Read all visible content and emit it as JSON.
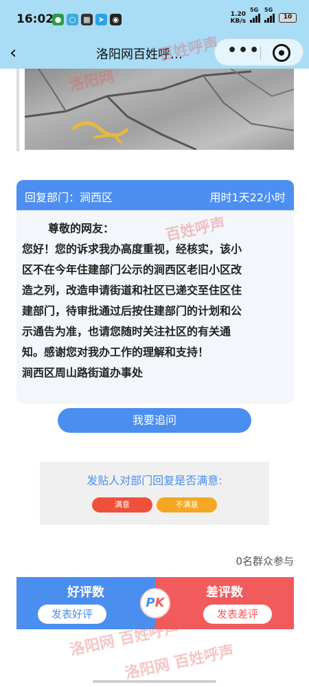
{
  "status_bar": {
    "time": "16:02",
    "net_speed_value": "1.20",
    "net_speed_unit": "KB/s",
    "signal1_label": "5G",
    "signal2_label": "5G",
    "battery": "10"
  },
  "nav": {
    "title": "洛阳网百姓呼…"
  },
  "reply": {
    "dept_label": "回复部门：涧西区",
    "duration": "用时1天22小时",
    "greeting": "尊敬的网友：",
    "lines": [
      "您好！您的诉求我办高度重视，经核实，该小",
      "区不在今年住建部门公示的涧西区老旧小区改",
      "造之列，改造申请街道和社区已递交至住区住",
      "建部门，待审批通过后按住建部门的计划和公",
      "示通告为准，也请您随时关注社区的有关通",
      "知。感谢您对我办工作的理解和支持！",
      "涧西区周山路街道办事处"
    ]
  },
  "followup_label": "我要追问",
  "satisfaction": {
    "title": "发贴人对部门回复是否满意:",
    "yes_label": "满意",
    "no_label": "不满意"
  },
  "participants": "0名群众参与",
  "reviews": {
    "good_title": "好评数",
    "good_button": "发表好评",
    "bad_title": "差评数",
    "bad_button": "发表差评",
    "pk_p": "P",
    "pk_k": "K"
  },
  "watermarks": {
    "a": "百姓呼声",
    "b": "洛阳网",
    "c": "百姓呼声",
    "d": "洛阳网 百姓呼声",
    "e": "洛阳网 百姓呼声"
  },
  "colors": {
    "nav_bg": "#a9dcf5",
    "accent_blue": "#4a8ef0",
    "accent_red": "#f25b5b",
    "satisfied": "#f0503a",
    "unsatisfied": "#f5a623"
  }
}
